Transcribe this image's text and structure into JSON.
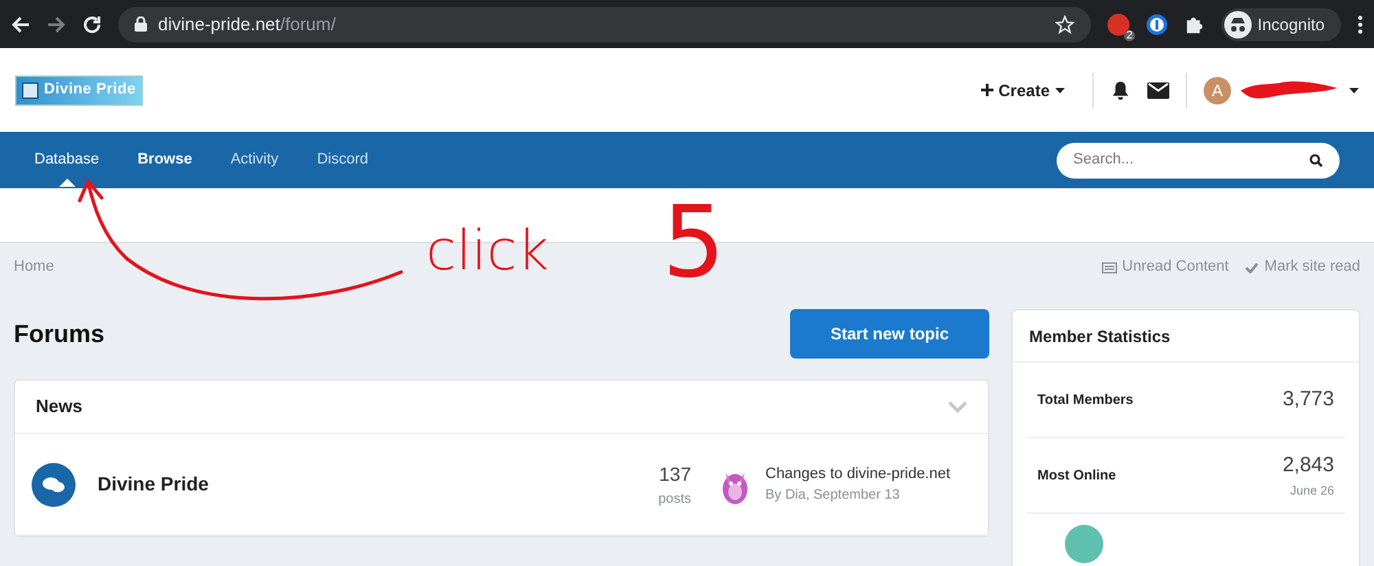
{
  "browser": {
    "url_host": "divine-pride.net",
    "url_path": "/forum/",
    "extension_badge": "2",
    "profile_label": "Incognito"
  },
  "header": {
    "logo_text": "Divine Pride",
    "create_label": "Create",
    "avatar_letter": "A"
  },
  "nav": {
    "items": [
      {
        "label": "Database",
        "selected": false,
        "expanded": true
      },
      {
        "label": "Browse",
        "selected": true,
        "expanded": false
      },
      {
        "label": "Activity",
        "selected": false,
        "expanded": false
      },
      {
        "label": "Discord",
        "selected": false,
        "expanded": false
      }
    ],
    "search": {
      "placeholder": "Search..."
    }
  },
  "breadcrumb": {
    "items": [
      "Home"
    ],
    "actions": [
      "Unread Content",
      "Mark site read"
    ]
  },
  "page": {
    "title": "Forums",
    "button": "Start new topic"
  },
  "category": {
    "title": "News",
    "expanded": true,
    "forums": [
      {
        "name": "Divine Pride",
        "posts": "137",
        "posts_label": "posts",
        "last_title": "Changes to divine-pride.net",
        "last_by": "By Dia, September 13"
      }
    ]
  },
  "stats": {
    "title": "Member Statistics",
    "rows": [
      {
        "label": "Total Members",
        "value": "3,773"
      },
      {
        "label": "Most Online",
        "value": "2,843",
        "sub": "June 26"
      }
    ]
  },
  "annotations": {
    "word": "click",
    "number": "5"
  }
}
